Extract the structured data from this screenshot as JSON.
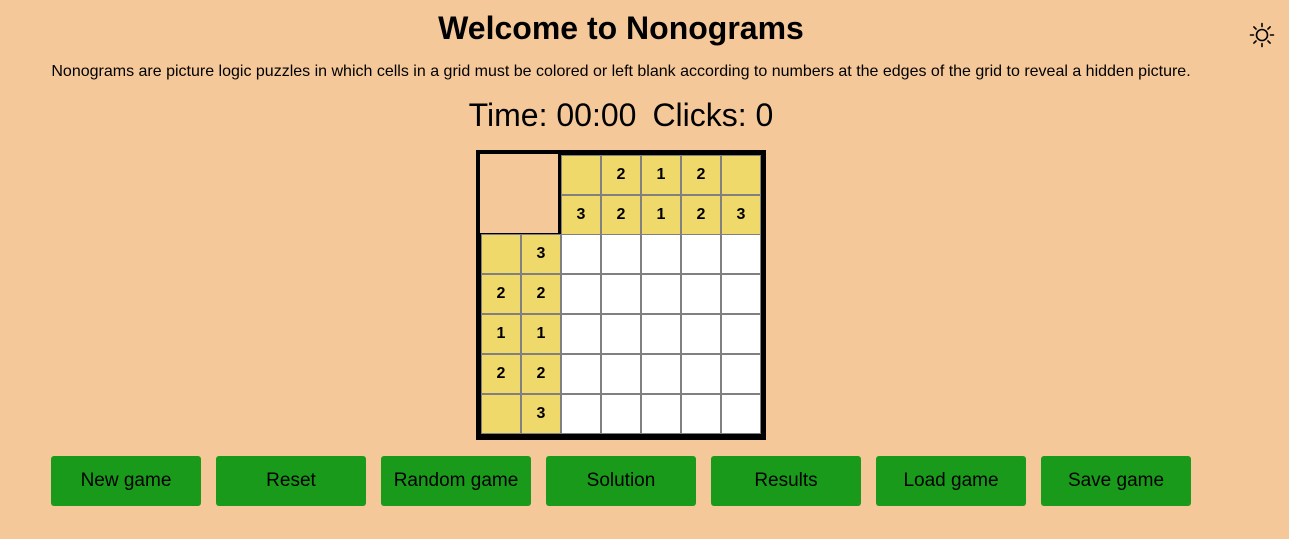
{
  "header": {
    "title": "Welcome to Nonograms",
    "description": "Nonograms are picture logic puzzles in which cells in a grid must be colored or left blank according to numbers at the edges of the grid to reveal a hidden picture.",
    "theme_toggle_icon": "sun-icon"
  },
  "stats": {
    "time_label": "Time:",
    "time_value": "00:00",
    "clicks_label": "Clicks:",
    "clicks_value": "0"
  },
  "puzzle": {
    "size": 5,
    "column_clues": [
      [
        "",
        "3"
      ],
      [
        "2",
        "2"
      ],
      [
        "1",
        "1"
      ],
      [
        "2",
        "2"
      ],
      [
        "",
        "3"
      ]
    ],
    "row_clues": [
      [
        "",
        "3"
      ],
      [
        "2",
        "2"
      ],
      [
        "1",
        "1"
      ],
      [
        "2",
        "2"
      ],
      [
        "",
        "3"
      ]
    ],
    "cells": [
      [
        0,
        0,
        0,
        0,
        0
      ],
      [
        0,
        0,
        0,
        0,
        0
      ],
      [
        0,
        0,
        0,
        0,
        0
      ],
      [
        0,
        0,
        0,
        0,
        0
      ],
      [
        0,
        0,
        0,
        0,
        0
      ]
    ]
  },
  "buttons": [
    {
      "id": "new-game-button",
      "label": "New game"
    },
    {
      "id": "reset-button",
      "label": "Reset"
    },
    {
      "id": "random-game-button",
      "label": "Random game"
    },
    {
      "id": "solution-button",
      "label": "Solution"
    },
    {
      "id": "results-button",
      "label": "Results"
    },
    {
      "id": "load-game-button",
      "label": "Load game"
    },
    {
      "id": "save-game-button",
      "label": "Save game"
    }
  ],
  "colors": {
    "background": "#f5c89a",
    "clue_cell": "#efd96b",
    "empty_cell": "#ffffff",
    "button": "#1a9a1a",
    "border": "#000000"
  }
}
